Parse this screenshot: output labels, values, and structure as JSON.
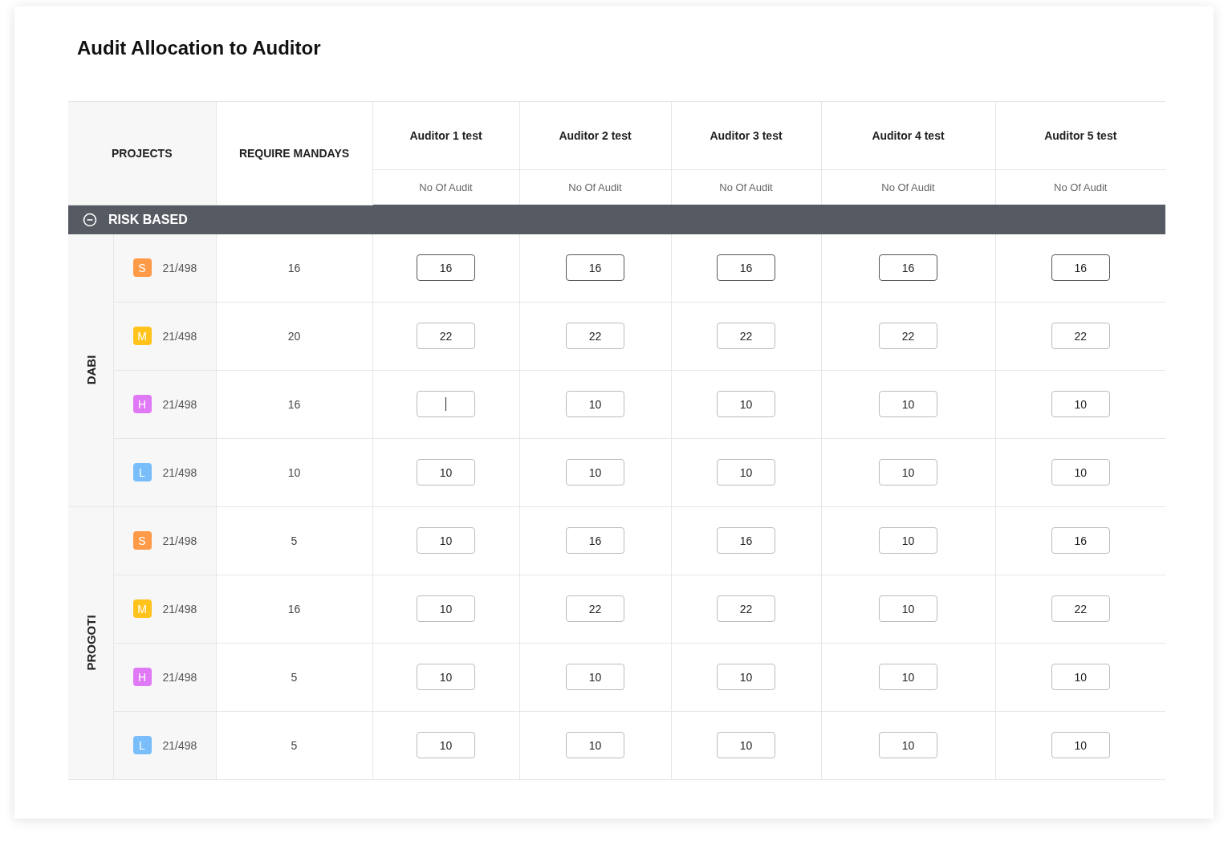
{
  "title": "Audit Allocation to Auditor",
  "columns": {
    "projects": "PROJECTS",
    "mandays": "REQUIRE MANDAYS",
    "auditors": [
      {
        "name": "Auditor 1 test",
        "sub": "No Of Audit"
      },
      {
        "name": "Auditor 2 test",
        "sub": "No Of Audit"
      },
      {
        "name": "Auditor 3 test",
        "sub": "No Of Audit"
      },
      {
        "name": "Auditor 4 test",
        "sub": "No Of Audit"
      },
      {
        "name": "Auditor 5 test",
        "sub": "No Of Audit"
      }
    ]
  },
  "section": {
    "label": "RISK BASED",
    "expanded": true
  },
  "groups": [
    {
      "name": "DABI",
      "rows": [
        {
          "badge": "S",
          "color": "#ff9a48",
          "code": "21/498",
          "mandays": "16",
          "highlighted": true,
          "cells": [
            {
              "value": "16"
            },
            {
              "value": "16"
            },
            {
              "value": "16"
            },
            {
              "value": "16"
            },
            {
              "value": "16"
            }
          ]
        },
        {
          "badge": "M",
          "color": "#ffc31c",
          "code": "21/498",
          "mandays": "20",
          "highlighted": false,
          "cells": [
            {
              "value": "22"
            },
            {
              "value": "22"
            },
            {
              "value": "22"
            },
            {
              "value": "22"
            },
            {
              "value": "22"
            }
          ]
        },
        {
          "badge": "H",
          "color": "#e079f5",
          "code": "21/498",
          "mandays": "16",
          "highlighted": false,
          "cells": [
            {
              "focused": true
            },
            {
              "value": "10"
            },
            {
              "value": "10"
            },
            {
              "value": "10"
            },
            {
              "value": "10"
            }
          ]
        },
        {
          "badge": "L",
          "color": "#79bdfb",
          "code": "21/498",
          "mandays": "10",
          "highlighted": false,
          "cells": [
            {
              "value": "10"
            },
            {
              "value": "10"
            },
            {
              "value": "10"
            },
            {
              "value": "10"
            },
            {
              "value": "10"
            }
          ]
        }
      ]
    },
    {
      "name": "PROGOTI",
      "rows": [
        {
          "badge": "S",
          "color": "#ff9a48",
          "code": "21/498",
          "mandays": "5",
          "highlighted": false,
          "cells": [
            {
              "value": "10"
            },
            {
              "value": "16"
            },
            {
              "value": "16"
            },
            {
              "value": "10"
            },
            {
              "value": "16"
            }
          ]
        },
        {
          "badge": "M",
          "color": "#ffc31c",
          "code": "21/498",
          "mandays": "16",
          "highlighted": false,
          "cells": [
            {
              "value": "10"
            },
            {
              "value": "22"
            },
            {
              "value": "22"
            },
            {
              "value": "10"
            },
            {
              "value": "22"
            }
          ]
        },
        {
          "badge": "H",
          "color": "#e079f5",
          "code": "21/498",
          "mandays": "5",
          "highlighted": false,
          "cells": [
            {
              "value": "10"
            },
            {
              "value": "10"
            },
            {
              "value": "10"
            },
            {
              "value": "10"
            },
            {
              "value": "10"
            }
          ]
        },
        {
          "badge": "L",
          "color": "#79bdfb",
          "code": "21/498",
          "mandays": "5",
          "highlighted": false,
          "cells": [
            {
              "value": "10"
            },
            {
              "value": "10"
            },
            {
              "value": "10"
            },
            {
              "value": "10"
            },
            {
              "value": "10"
            }
          ]
        }
      ]
    }
  ]
}
